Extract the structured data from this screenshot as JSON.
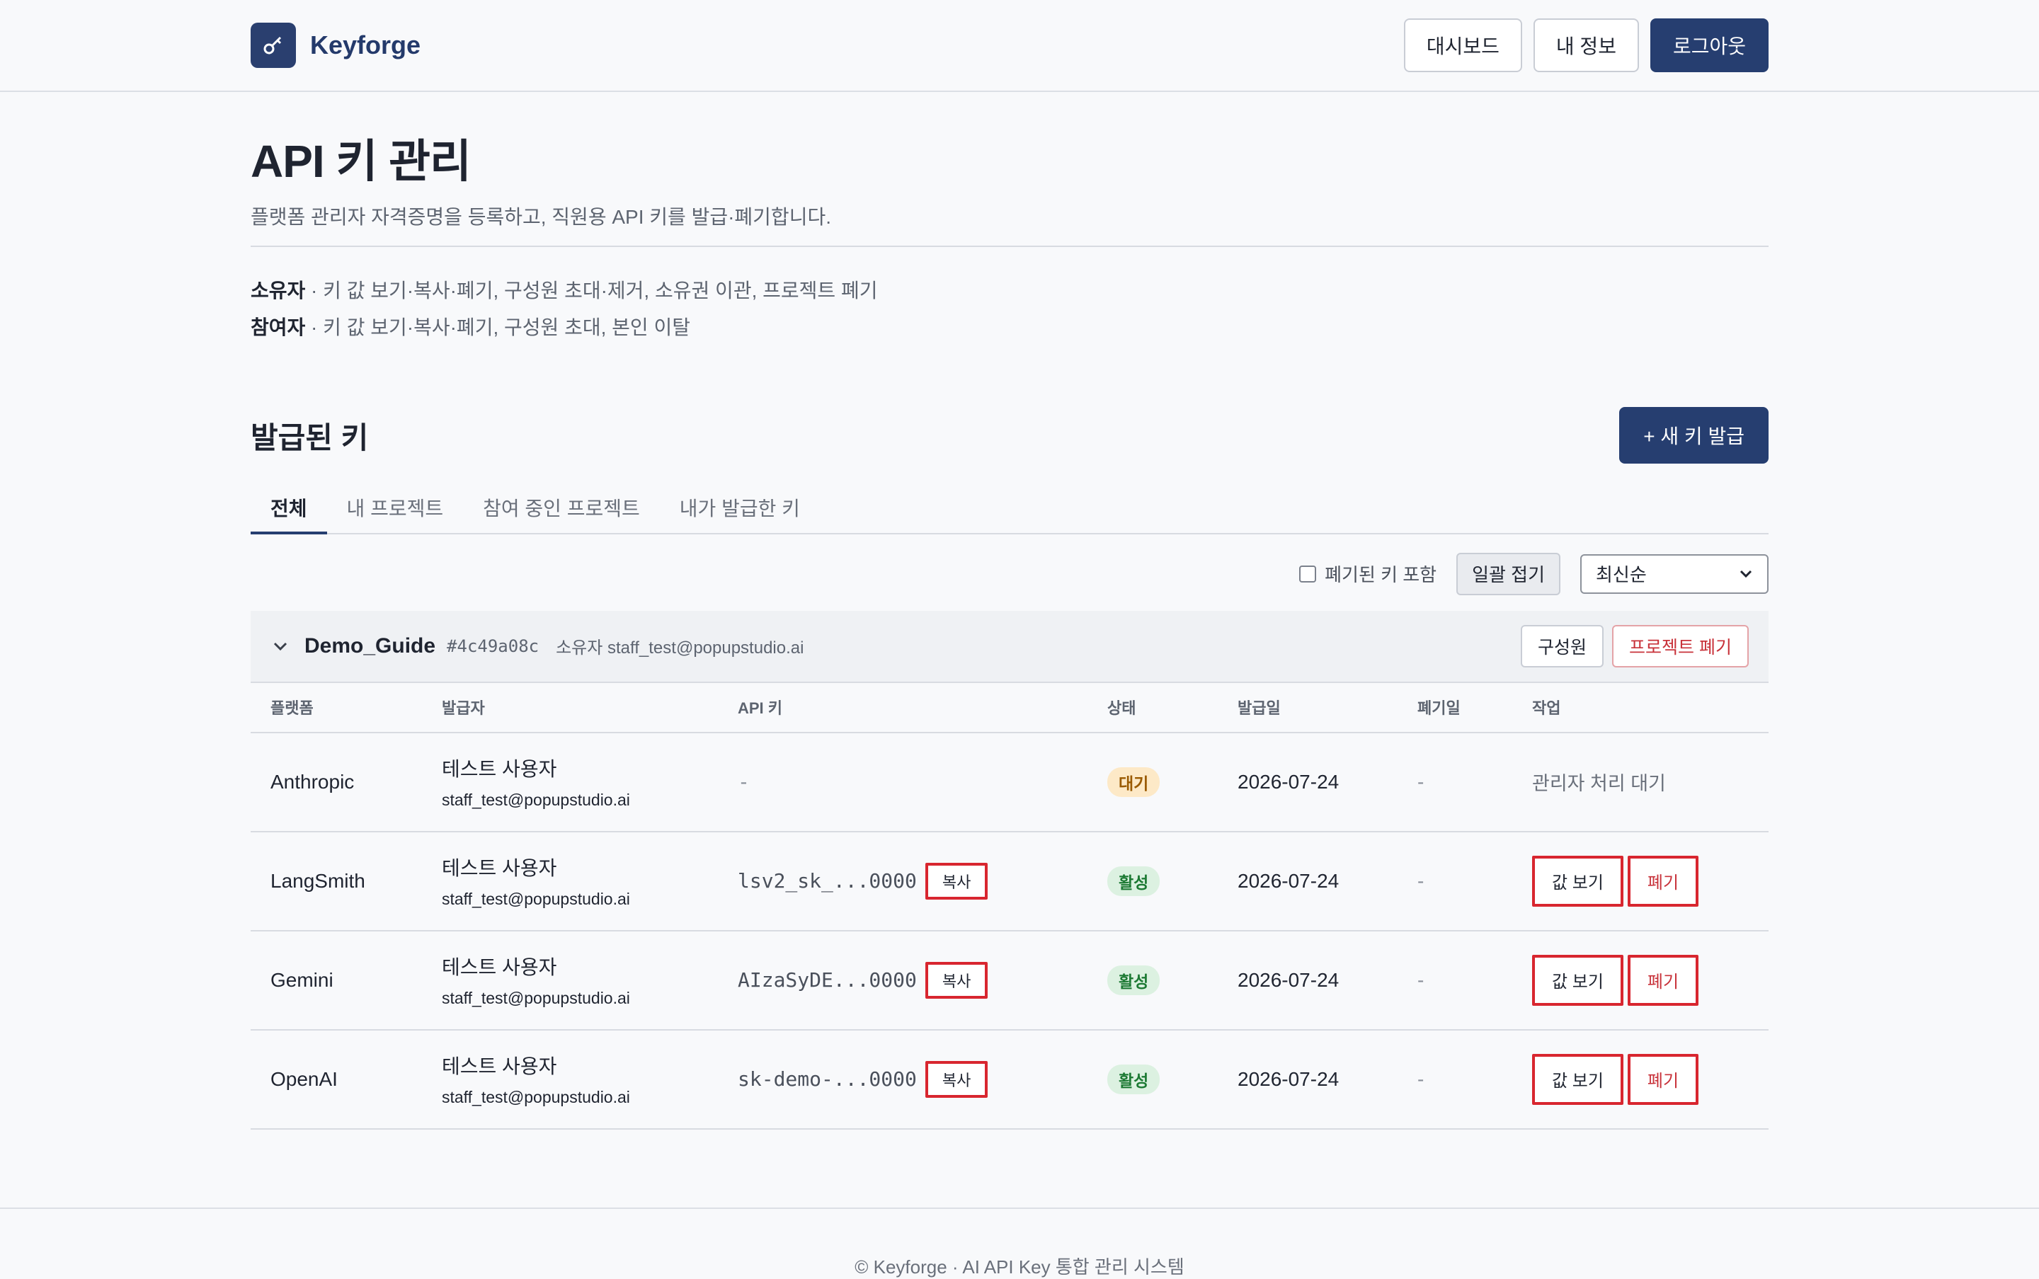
{
  "header": {
    "brand": "Keyforge",
    "buttons": {
      "dashboard": "대시보드",
      "profile": "내 정보",
      "logout": "로그아웃"
    }
  },
  "page": {
    "title": "API 키 관리",
    "subtitle": "플랫폼 관리자 자격증명을 등록하고, 직원용 API 키를 발급·폐기합니다.",
    "roles": [
      {
        "name": "소유자",
        "desc": " · 키 값 보기·복사·폐기, 구성원 초대·제거, 소유권 이관, 프로젝트 폐기"
      },
      {
        "name": "참여자",
        "desc": " · 키 값 보기·복사·폐기, 구성원 초대, 본인 이탈"
      }
    ]
  },
  "keys_section": {
    "title": "발급된 키",
    "new_key_label": "+ 새 키 발급",
    "tabs": [
      "전체",
      "내 프로젝트",
      "참여 중인 프로젝트",
      "내가 발급한 키"
    ],
    "active_tab": 0,
    "include_revoked_label": "폐기된 키 포함",
    "collapse_all_label": "일괄 접기",
    "sort_value": "최신순"
  },
  "project": {
    "name": "Demo_Guide",
    "id": "#4c49a08c",
    "owner": "소유자 staff_test@popupstudio.ai",
    "members_label": "구성원",
    "delete_label": "프로젝트 폐기"
  },
  "table": {
    "headers": [
      "플랫폼",
      "발급자",
      "API 키",
      "상태",
      "발급일",
      "폐기일",
      "작업"
    ],
    "copy_label": "복사",
    "view_label": "값 보기",
    "revoke_label": "폐기",
    "rows": [
      {
        "platform": "Anthropic",
        "issuer": "테스트 사용자",
        "email": "staff_test@popupstudio.ai",
        "key": "-",
        "status": "대기",
        "status_type": "pending",
        "issued": "2026-07-24",
        "revoked": "-",
        "action_text": "관리자 처리 대기"
      },
      {
        "platform": "LangSmith",
        "issuer": "테스트 사용자",
        "email": "staff_test@popupstudio.ai",
        "key": "lsv2_sk_...0000",
        "status": "활성",
        "status_type": "active",
        "issued": "2026-07-24",
        "revoked": "-",
        "action_text": ""
      },
      {
        "platform": "Gemini",
        "issuer": "테스트 사용자",
        "email": "staff_test@popupstudio.ai",
        "key": "AIzaSyDE...0000",
        "status": "활성",
        "status_type": "active",
        "issued": "2026-07-24",
        "revoked": "-",
        "action_text": ""
      },
      {
        "platform": "OpenAI",
        "issuer": "테스트 사용자",
        "email": "staff_test@popupstudio.ai",
        "key": "sk-demo-...0000",
        "status": "활성",
        "status_type": "active",
        "issued": "2026-07-24",
        "revoked": "-",
        "action_text": ""
      }
    ]
  },
  "footer": {
    "text": "© Keyforge · AI API Key 통합 관리 시스템"
  }
}
